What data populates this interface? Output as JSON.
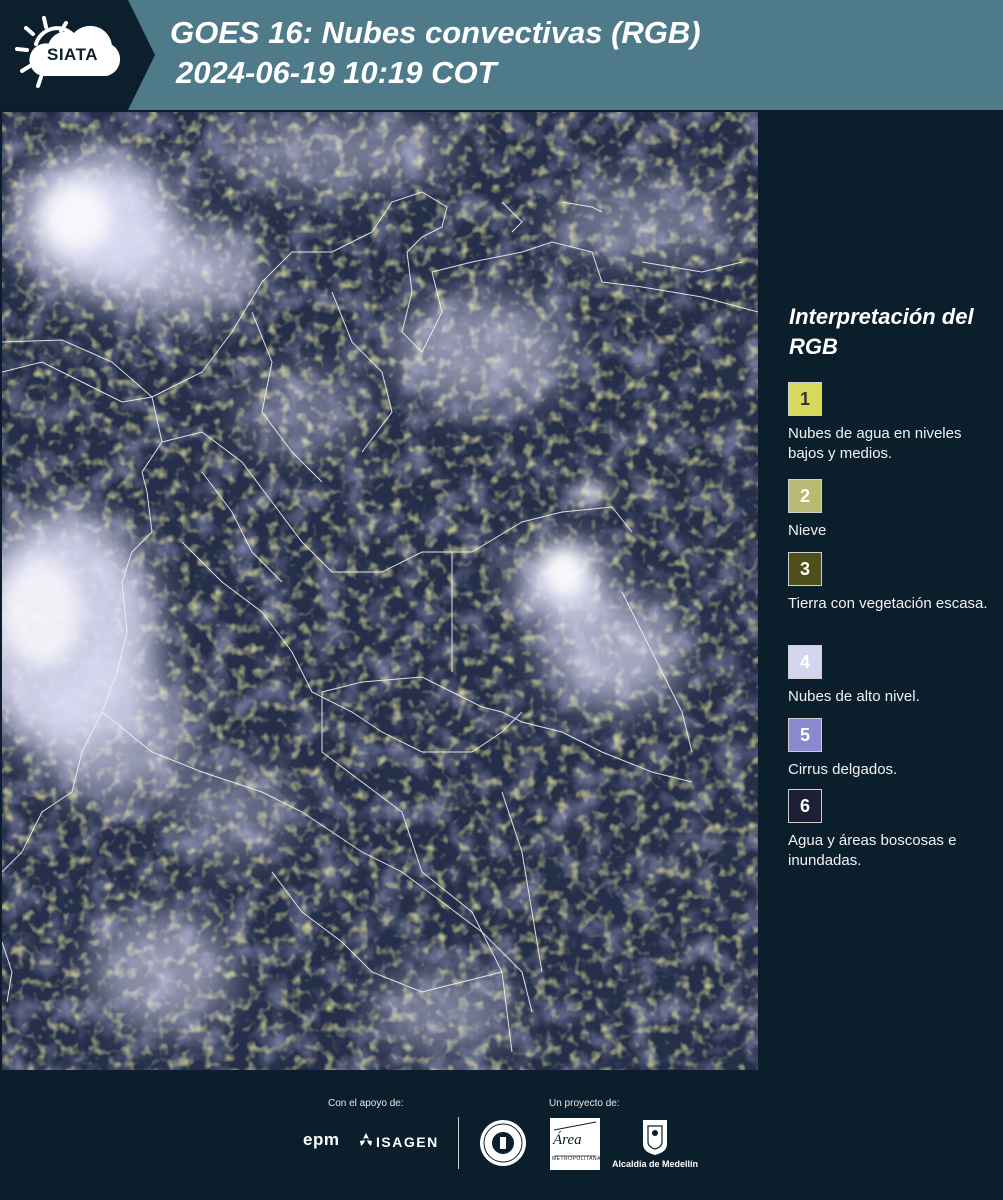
{
  "header": {
    "brand": "SIATA",
    "title": "GOES 16: Nubes convectivas (RGB)",
    "datetime": "2024-06-19 10:19 COT"
  },
  "legend": {
    "title": "Interpretación del RGB",
    "items": [
      {
        "number": "1",
        "description": "Nubes de agua en niveles bajos y medios.",
        "color": "#d8d85a",
        "text_color": "#333333"
      },
      {
        "number": "2",
        "description": "Nieve",
        "color": "#b9b974",
        "text_color": "#ffffff"
      },
      {
        "number": "3",
        "description": "Tierra con vegetación escasa.",
        "color": "#4f4f1c",
        "text_color": "#ffffff"
      },
      {
        "number": "4",
        "description": "Nubes de alto nivel.",
        "color": "#d4d4ee",
        "text_color": "#ffffff"
      },
      {
        "number": "5",
        "description": "Cirrus delgados.",
        "color": "#8a8ad0",
        "text_color": "#ffffff"
      },
      {
        "number": "6",
        "description": "Agua y áreas boscosas e inundadas.",
        "color": "#1e1e36",
        "text_color": "#ffffff"
      }
    ]
  },
  "footer": {
    "support_label": "Con el apoyo de:",
    "project_label": "Un proyecto de:",
    "sponsors": [
      "epm",
      "ISAGEN"
    ],
    "partners": {
      "area": "Área",
      "area_sub": "METROPOLITANA Valle de Aburrá",
      "alcaldia": "Alcaldía de Medellín"
    }
  },
  "colors": {
    "header_bg": "#4e7a89",
    "panel_bg": "#0a1e2c",
    "map_base": "#262f4a",
    "cloud_high": "#e6e6f8",
    "cloud_low": "#d8d85a"
  }
}
